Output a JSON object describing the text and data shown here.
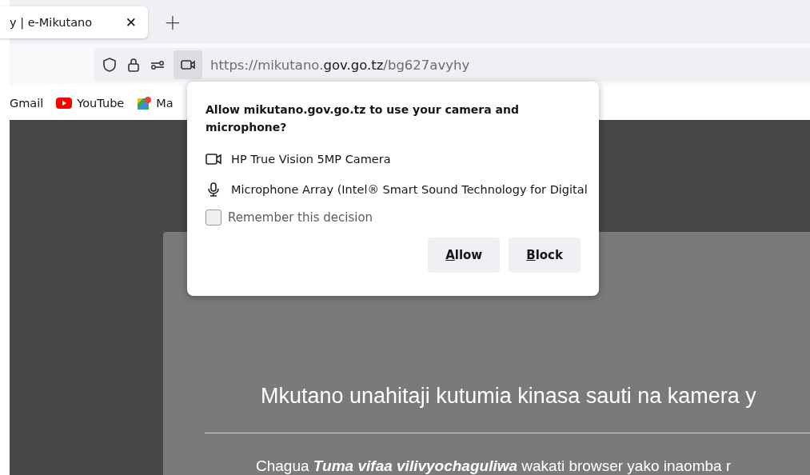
{
  "tab": {
    "title": "y | e-Mikutano",
    "close": "✕",
    "new_tab": "+"
  },
  "address_bar": {
    "scheme_host": "https://mikutano.",
    "domain": "gov.go.tz",
    "path": "/bg627avyhy",
    "camera_active": true
  },
  "bookmarks": [
    {
      "label": "Gmail",
      "kind": "plain"
    },
    {
      "label": "YouTube",
      "kind": "youtube"
    },
    {
      "label": "Ma",
      "kind": "maps"
    }
  ],
  "permission_popup": {
    "question": "Allow mikutano.gov.go.tz to use your camera and microphone?",
    "devices": [
      {
        "kind": "camera",
        "label": "HP True Vision 5MP Camera"
      },
      {
        "kind": "microphone",
        "label": "Microphone Array (Intel® Smart Sound Technology for Digital"
      }
    ],
    "remember": {
      "label": "Remember this decision",
      "checked": false
    },
    "buttons": [
      "Allow",
      "Block"
    ]
  },
  "page": {
    "heading": "Mkutano unahitaji kutumia kinasa sauti na kamera y",
    "instruction": "Chagua **Tuma vifaa vilivyochaguliwa** wakati browser yako inaomba r"
  }
}
